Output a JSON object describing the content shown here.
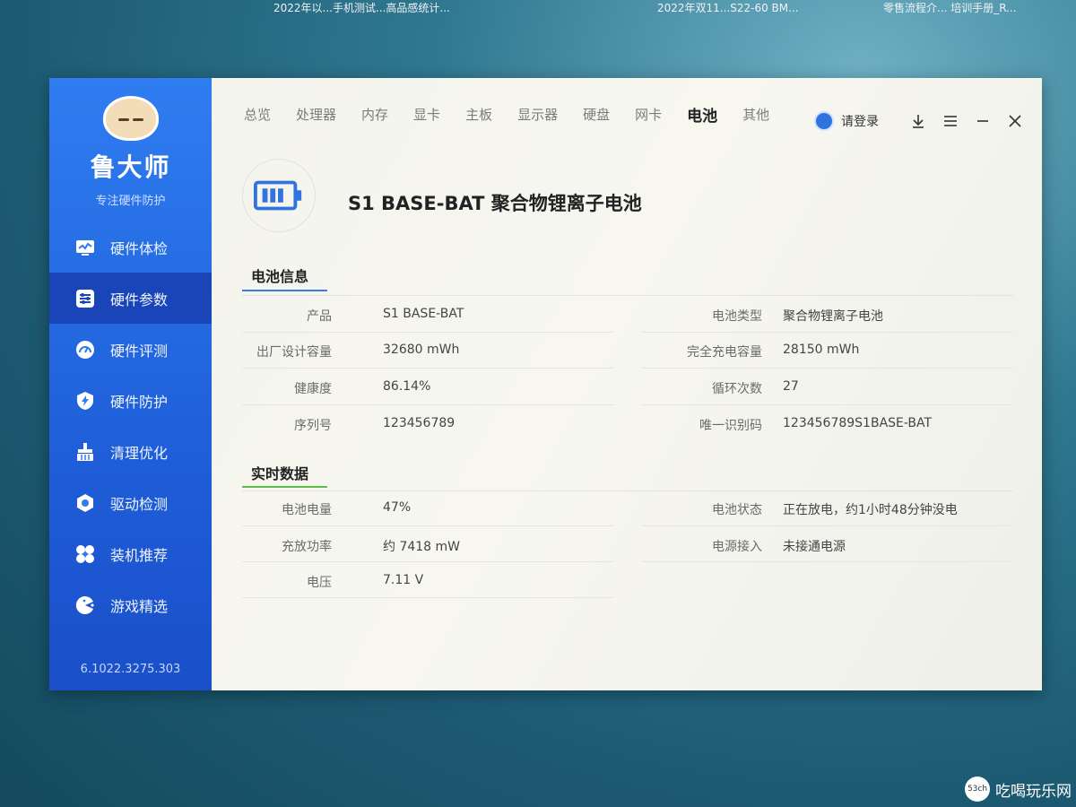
{
  "desktop": {
    "items": [
      "2022年以...手机测试...高品感统计...",
      "2022年双11...S22-60 BM...",
      "零售流程介... 培训手册_R..."
    ]
  },
  "app": {
    "brand": "鲁大师",
    "slogan": "专注硬件防护",
    "version": "6.1022.3275.303"
  },
  "sidebar": {
    "items": [
      {
        "label": "硬件体检",
        "icon": "monitor-pulse-icon"
      },
      {
        "label": "硬件参数",
        "icon": "sliders-icon",
        "active": true
      },
      {
        "label": "硬件评测",
        "icon": "gauge-icon"
      },
      {
        "label": "硬件防护",
        "icon": "shield-bolt-icon"
      },
      {
        "label": "清理优化",
        "icon": "broom-icon"
      },
      {
        "label": "驱动检测",
        "icon": "hex-gear-icon"
      },
      {
        "label": "装机推荐",
        "icon": "fan-icon"
      },
      {
        "label": "游戏精选",
        "icon": "pacman-icon"
      }
    ]
  },
  "tabs": [
    "总览",
    "处理器",
    "内存",
    "显卡",
    "主板",
    "显示器",
    "硬盘",
    "网卡",
    "电池",
    "其他"
  ],
  "active_tab": "电池",
  "header": {
    "login": "请登录"
  },
  "device": {
    "title": "S1 BASE-BAT 聚合物锂离子电池"
  },
  "battery_info": {
    "section": "电池信息",
    "rows": [
      {
        "l1": "产品",
        "v1": "S1 BASE-BAT",
        "l2": "电池类型",
        "v2": "聚合物锂离子电池"
      },
      {
        "l1": "出厂设计容量",
        "v1": "32680 mWh",
        "l2": "完全充电容量",
        "v2": "28150 mWh"
      },
      {
        "l1": "健康度",
        "v1": "86.14%",
        "l2": "循环次数",
        "v2": "27"
      },
      {
        "l1": "序列号",
        "v1": "123456789",
        "l2": "唯一识别码",
        "v2": "123456789S1BASE-BAT"
      }
    ]
  },
  "realtime": {
    "section": "实时数据",
    "rows": [
      {
        "l1": "电池电量",
        "v1": "47%",
        "l2": "电池状态",
        "v2": "正在放电，约1小时48分钟没电"
      },
      {
        "l1": "充放功率",
        "v1": "约 7418 mW",
        "l2": "电源接入",
        "v2": "未接通电源"
      },
      {
        "l1": "电压",
        "v1": "7.11 V",
        "l2": "",
        "v2": ""
      }
    ]
  },
  "colors": {
    "accent_blue": "#2f7df0",
    "section1_underline": "#3a7be8",
    "section2_underline": "#5bbf4a"
  },
  "watermark": {
    "badge": "53ch",
    "text": "吃喝玩乐网"
  }
}
